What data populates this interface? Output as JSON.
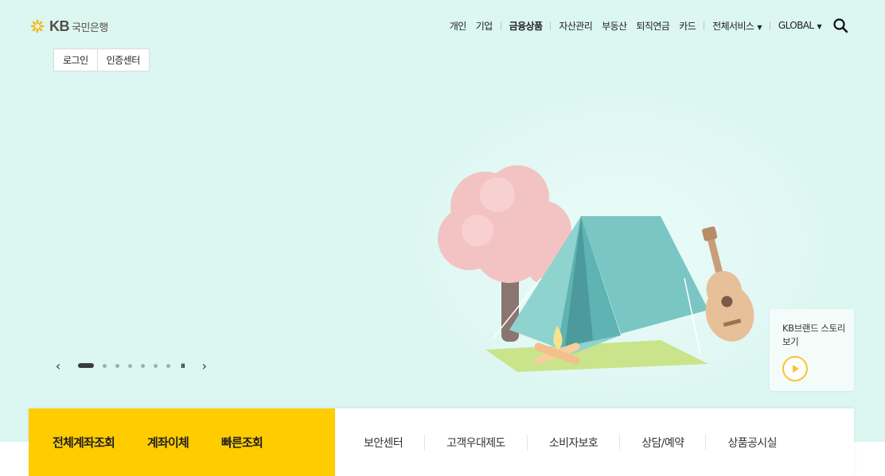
{
  "logo": {
    "kb": "KB",
    "name": "국민은행"
  },
  "gnb": {
    "items": [
      "개인",
      "기업",
      "금융상품",
      "자산관리",
      "부동산",
      "퇴직연금",
      "카드",
      "전체서비스",
      "GLOBAL"
    ],
    "caret": "▼"
  },
  "login": {
    "login_label": "로그인",
    "cert_label": "인증센터"
  },
  "slider": {
    "prev": "‹",
    "next": "›",
    "pause": "ıı",
    "total_slides": 7,
    "active_slide": 1
  },
  "brand_card": {
    "text": "KB브랜드 스토리 보기"
  },
  "quick_main": [
    "전체계좌조회",
    "계좌이체",
    "빠른조회"
  ],
  "quick_sub": [
    "보안센터",
    "고객우대제도",
    "소비자보호",
    "상담/예약",
    "상품공시실"
  ],
  "colors": {
    "hero_bg": "#dcf6f1",
    "accent_yellow": "#ffcc00",
    "logo_star": "#f6b90e"
  },
  "icons": {
    "logo": "kb-star-icon",
    "search": "search-icon",
    "play": "play-icon"
  }
}
